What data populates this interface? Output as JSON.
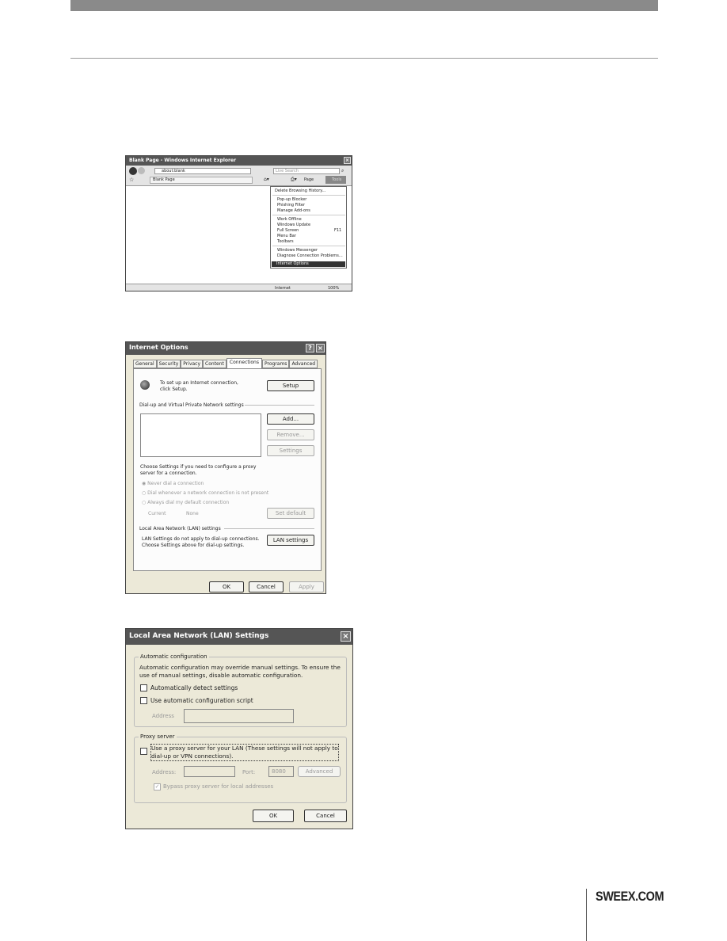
{
  "brand": "SWEEX.COM",
  "ie": {
    "title": "Blank Page - Windows Internet Explorer",
    "address": "about:blank",
    "search_placeholder": "Live Search",
    "tab": "Blank Page",
    "page_label": "Page",
    "tools_label": "Tools",
    "status_zone": "Internet",
    "zoom": "100%",
    "menu": [
      "Delete Browsing History...",
      "Pop-up Blocker",
      "Phishing Filter",
      "Manage Add-ons",
      "Work Offline",
      "Windows Update",
      "Full Screen",
      "Menu Bar",
      "Toolbars",
      "Windows Messenger",
      "Diagnose Connection Problems...",
      "Internet Options"
    ],
    "fullscreen_shortcut": "F11"
  },
  "io": {
    "title": "Internet Options",
    "tabs": [
      "General",
      "Security",
      "Privacy",
      "Content",
      "Connections",
      "Programs",
      "Advanced"
    ],
    "active_tab": "Connections",
    "setup_text": "To set up an Internet connection, click Setup.",
    "setup": "Setup",
    "dialup_header": "Dial-up and Virtual Private Network settings",
    "add": "Add...",
    "remove": "Remove...",
    "settings": "Settings",
    "proxy_text": "Choose Settings if you need to configure a proxy server for a connection.",
    "radios": [
      "Never dial a connection",
      "Dial whenever a network connection is not present",
      "Always dial my default connection"
    ],
    "current_label": "Current",
    "current_value": "None",
    "set_default": "Set default",
    "lan_header": "Local Area Network (LAN) settings",
    "lan_text": "LAN Settings do not apply to dial-up connections. Choose Settings above for dial-up settings.",
    "lan_settings": "LAN settings",
    "ok": "OK",
    "cancel": "Cancel",
    "apply": "Apply"
  },
  "lan": {
    "title": "Local Area Network (LAN) Settings",
    "auto_group": "Automatic configuration",
    "auto_text": "Automatic configuration may override manual settings.  To ensure the use of manual settings, disable automatic configuration.",
    "auto_detect": "Automatically detect settings",
    "auto_script": "Use automatic configuration script",
    "address_label": "Address",
    "proxy_group": "Proxy server",
    "use_proxy": "Use a proxy server for your LAN (These settings will not apply to dial-up or VPN connections).",
    "proxy_address_label": "Address:",
    "port_label": "Port:",
    "port_value": "8080",
    "advanced": "Advanced",
    "bypass": "Bypass proxy server for local addresses",
    "ok": "OK",
    "cancel": "Cancel"
  }
}
